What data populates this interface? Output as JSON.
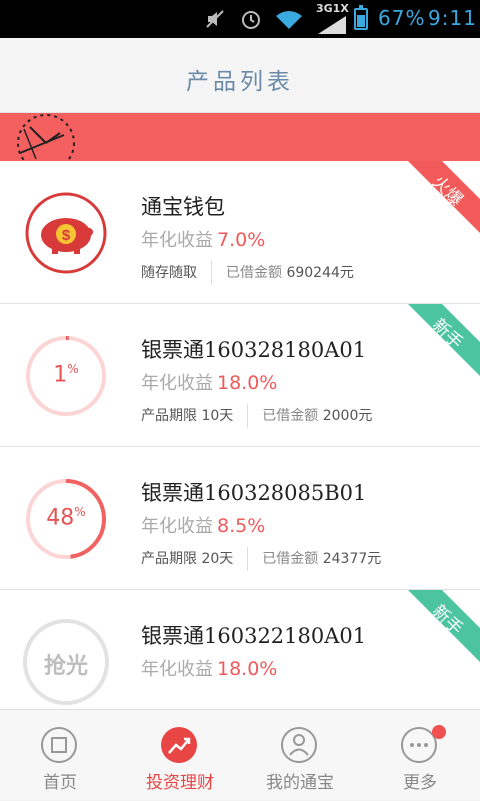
{
  "status_bar": {
    "network": "3G1X",
    "battery": "67%",
    "time": "9:11"
  },
  "header": {
    "title": "产品列表"
  },
  "products": [
    {
      "name": "通宝钱包",
      "rate_label": "年化收益",
      "rate": "7.0%",
      "term": "随存随取",
      "amount_label": "已借金额",
      "amount": "690244元",
      "badge": "火爆",
      "badge_color": "#f25a5a",
      "icon": "piggy-bank-icon"
    },
    {
      "name": "银票通160328180A01",
      "rate_label": "年化收益",
      "rate": "18.0%",
      "term": "产品期限 10天",
      "amount_label": "已借金额",
      "amount": "2000元",
      "badge": "新手",
      "badge_color": "#4cc4a0",
      "progress": "1",
      "progress_unit": "%",
      "progress_fraction": 0.01
    },
    {
      "name": "银票通160328085B01",
      "rate_label": "年化收益",
      "rate": "8.5%",
      "term": "产品期限 20天",
      "amount_label": "已借金额",
      "amount": "24377元",
      "progress": "48",
      "progress_unit": "%",
      "progress_fraction": 0.48
    },
    {
      "name": "银票通160322180A01",
      "rate_label": "年化收益",
      "rate": "18.0%",
      "badge": "新手",
      "badge_color": "#4cc4a0",
      "sold_out": "抢光"
    }
  ],
  "tabs": [
    {
      "label": "首页",
      "icon": "home-square-icon",
      "active": false
    },
    {
      "label": "投资理财",
      "icon": "trend-chart-icon",
      "active": true
    },
    {
      "label": "我的通宝",
      "icon": "user-icon",
      "active": false
    },
    {
      "label": "更多",
      "icon": "more-dots-icon",
      "active": false
    }
  ],
  "colors": {
    "accent": "#f45f5f",
    "title": "#6a8aa8",
    "badge_new": "#4cc4a0"
  }
}
